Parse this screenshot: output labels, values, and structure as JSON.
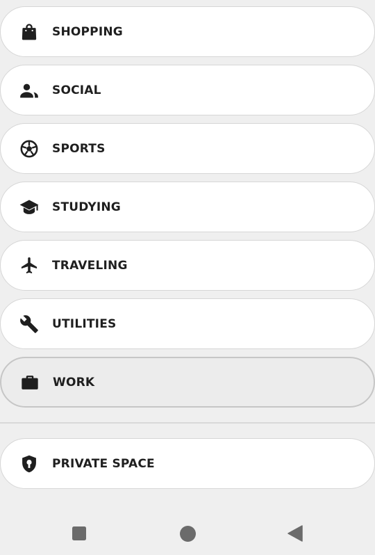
{
  "categories": [
    {
      "label": "SHOPPING",
      "icon": "shopping-bag-icon"
    },
    {
      "label": "SOCIAL",
      "icon": "people-icon"
    },
    {
      "label": "SPORTS",
      "icon": "soccer-ball-icon"
    },
    {
      "label": "STUDYING",
      "icon": "graduation-cap-icon"
    },
    {
      "label": "TRAVELING",
      "icon": "airplane-icon"
    },
    {
      "label": "UTILITIES",
      "icon": "wrench-icon"
    },
    {
      "label": "WORK",
      "icon": "briefcase-icon",
      "selected": true
    }
  ],
  "private_space": {
    "label": "PRIVATE SPACE",
    "icon": "shield-keyhole-icon"
  },
  "navbar": {
    "recents": "recents-square-icon",
    "home": "home-circle-icon",
    "back": "back-triangle-icon"
  },
  "colors": {
    "background": "#efefef",
    "pill": "#ffffff",
    "selected_pill": "#ececec",
    "text": "#1f1f1f",
    "nav_icon": "#6b6b6b"
  }
}
